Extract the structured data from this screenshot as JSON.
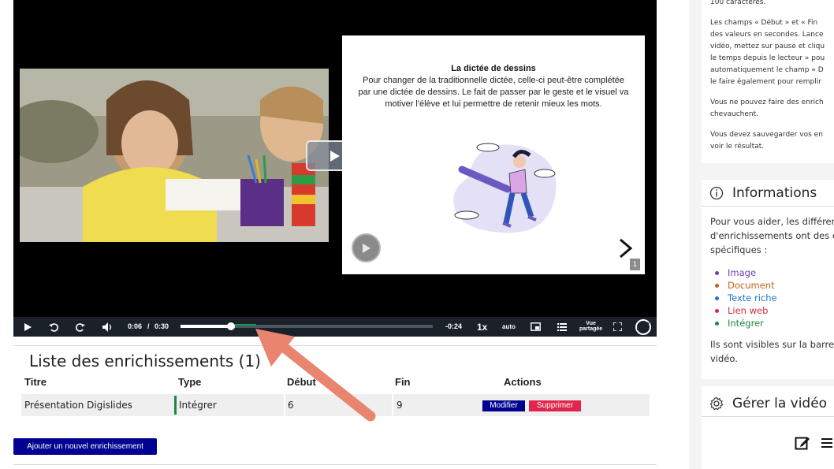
{
  "player": {
    "slide": {
      "title": "La dictée de dessins",
      "body_lines": [
        "Pour changer de la traditionnelle dictée, celle-ci peut-être complétée",
        "par une dictée de dessins. Le fait de passer par le geste et le visuel va",
        "motiver l'élève et lui permettre de retenir mieux les mots."
      ],
      "page_number": "1"
    },
    "controls": {
      "current_time": "0:06",
      "separator": "/",
      "duration": "0:30",
      "remaining": "-0:24",
      "speed": "1x",
      "quality": "auto",
      "view_line1": "Vue",
      "view_line2": "partagée",
      "progress_fraction": 0.2,
      "enrichment_start_fraction": 0.2,
      "enrichment_end_fraction": 0.3
    }
  },
  "list": {
    "title": "Liste des enrichissements (1)",
    "columns": [
      "Titre",
      "Type",
      "Début",
      "Fin",
      "Actions"
    ],
    "rows": [
      {
        "title": "Présentation Digislides",
        "type": "Intégrer",
        "start": "6",
        "end": "9"
      }
    ],
    "edit_label": "Modifier",
    "delete_label": "Supprimer",
    "add_label": "Ajouter un nouvel enrichissement"
  },
  "sidebar": {
    "help_lines": [
      "100 caractères.",
      "",
      "Les champs « Début » et « Fin",
      "des valeurs en secondes. Lance",
      "vidéo, mettez sur pause et cliqu",
      "le temps depuis le lecteur » pou",
      "automatiquement le champ « D",
      "le faire également pour remplir",
      "",
      "Vous ne pouvez faire des enrich",
      "chevauchent.",
      "",
      "Vous devez sauvegarder vos en",
      "voir le résultat."
    ],
    "info_title": "Informations",
    "info_lines": [
      "Pour vous aider, les différer",
      "d'enrichissements ont des c",
      "spécifiques :"
    ],
    "types": [
      {
        "label": "Image",
        "color": "#6e3fb5"
      },
      {
        "label": "Document",
        "color": "#c4611c"
      },
      {
        "label": "Texte riche",
        "color": "#1f76c8"
      },
      {
        "label": "Lien web",
        "color": "#d8293f"
      },
      {
        "label": "Intégrer",
        "color": "#1b8a43"
      }
    ],
    "visible_lines": [
      "Ils sont visibles sur la barre",
      "vidéo."
    ],
    "manage_title": "Gérer la vidéo"
  },
  "colors": {
    "primary": "#000091",
    "danger": "#e1264d",
    "embed_green": "#1b8a43",
    "annotation_arrow": "#e9846f"
  }
}
